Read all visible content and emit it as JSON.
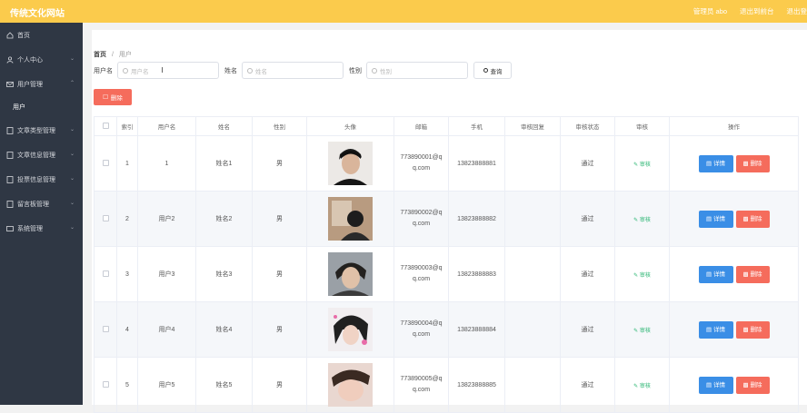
{
  "header": {
    "title": "传统文化网站",
    "links": [
      "管理员 abo",
      "退出到前台",
      "退出登"
    ]
  },
  "sidebar": {
    "items": [
      {
        "label": "首页",
        "icon": "home-icon"
      },
      {
        "label": "个人中心",
        "icon": "user-icon"
      },
      {
        "label": "用户管理",
        "icon": "mail-icon"
      },
      {
        "label": "文章类型管理",
        "icon": "doc-icon"
      },
      {
        "label": "文章信息管理",
        "icon": "doc-icon"
      },
      {
        "label": "投票信息管理",
        "icon": "doc-icon"
      },
      {
        "label": "留言板管理",
        "icon": "doc-icon"
      },
      {
        "label": "系统管理",
        "icon": "settings-icon"
      }
    ],
    "sub_item": "用户"
  },
  "breadcrumb": {
    "home": "首页",
    "sep": "/",
    "current": "用户"
  },
  "search": {
    "username_label": "用户名",
    "username_placeholder": "用户名",
    "name_label": "姓名",
    "name_placeholder": "姓名",
    "gender_label": "性别",
    "gender_placeholder": "性别",
    "query_label": "查询"
  },
  "toolbar": {
    "delete_label": "删除"
  },
  "table": {
    "headers": [
      "",
      "索引",
      "用户名",
      "姓名",
      "性别",
      "头像",
      "邮箱",
      "手机",
      "审核回复",
      "审核状态",
      "审核",
      "操作"
    ],
    "rows": [
      {
        "index": "1",
        "username": "1",
        "name": "姓名1",
        "gender": "男",
        "email1": "773890001@q",
        "email2": "q.com",
        "phone": "13823888881",
        "reply": "",
        "status": "通过",
        "audit": "审核"
      },
      {
        "index": "2",
        "username": "用户2",
        "name": "姓名2",
        "gender": "男",
        "email1": "773890002@q",
        "email2": "q.com",
        "phone": "13823888882",
        "reply": "",
        "status": "通过",
        "audit": "审核"
      },
      {
        "index": "3",
        "username": "用户3",
        "name": "姓名3",
        "gender": "男",
        "email1": "773890003@q",
        "email2": "q.com",
        "phone": "13823888883",
        "reply": "",
        "status": "通过",
        "audit": "审核"
      },
      {
        "index": "4",
        "username": "用户4",
        "name": "姓名4",
        "gender": "男",
        "email1": "773890004@q",
        "email2": "q.com",
        "phone": "13823888884",
        "reply": "",
        "status": "通过",
        "audit": "审核"
      },
      {
        "index": "5",
        "username": "用户5",
        "name": "姓名5",
        "gender": "男",
        "email1": "773890005@q",
        "email2": "q.com",
        "phone": "13823888885",
        "reply": "",
        "status": "通过",
        "audit": "审核"
      }
    ],
    "detail_label": "详情",
    "delete_label": "删除"
  },
  "colors": {
    "header": "#fbcb4c",
    "sidebar": "#2f3744",
    "primary": "#3a8ee6",
    "danger": "#f56c5c",
    "success": "#2bb673"
  }
}
